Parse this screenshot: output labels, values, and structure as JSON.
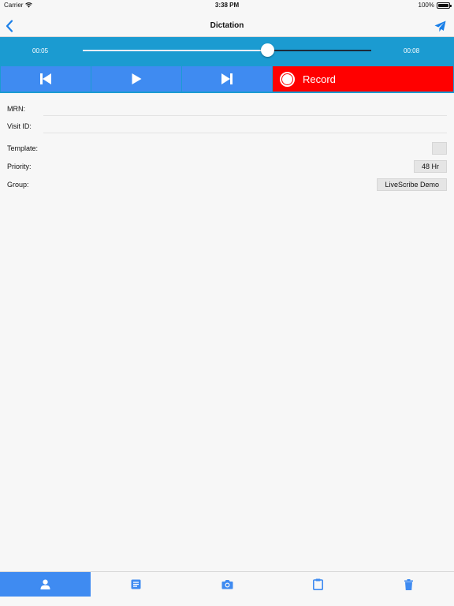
{
  "status_bar": {
    "carrier": "Carrier",
    "time": "3:38 PM",
    "battery": "100%"
  },
  "nav": {
    "title": "Dictation",
    "back_icon": "chevron-left-icon",
    "send_icon": "paper-plane-icon"
  },
  "player": {
    "elapsed": "00:05",
    "duration": "00:08",
    "progress": 0.64,
    "controls": [
      "skip-to-start-icon",
      "play-icon",
      "skip-to-end-icon"
    ],
    "record_label": "Record"
  },
  "form": {
    "mrn_label": "MRN:",
    "visit_label": "Visit ID:",
    "template_label": "Template:",
    "template_value": "",
    "priority_label": "Priority:",
    "priority_value": "48 Hr",
    "group_label": "Group:",
    "group_value": "LiveScribe Demo"
  },
  "tabs": [
    {
      "icon": "person-icon",
      "active": true
    },
    {
      "icon": "document-icon",
      "active": false
    },
    {
      "icon": "camera-icon",
      "active": false
    },
    {
      "icon": "clipboard-icon",
      "active": false
    },
    {
      "icon": "trash-icon",
      "active": false
    }
  ],
  "colors": {
    "accent": "#3f8bf1",
    "player_bg": "#1b9bd1",
    "record": "#ff0000"
  }
}
